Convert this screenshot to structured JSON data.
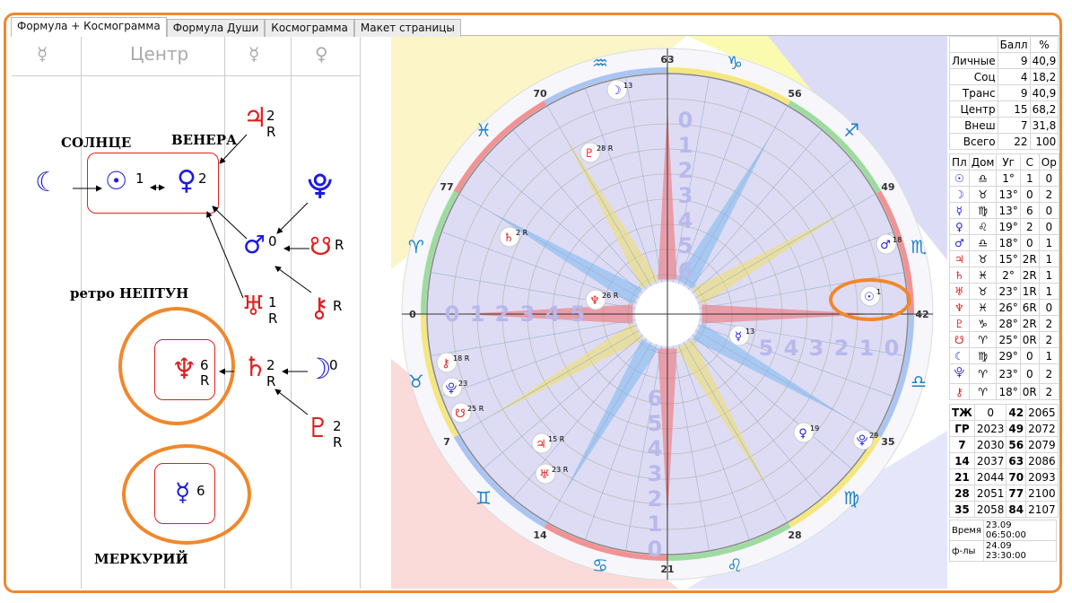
{
  "tabs": [
    "Формула + Космограмма",
    "Формула Души",
    "Космограмма",
    "Макет страницы"
  ],
  "active_tab": 0,
  "formula": {
    "headers": [
      "☿",
      "Центр",
      "☿",
      "♀"
    ],
    "labels": {
      "sun": "СОЛНЦЕ",
      "venus": "ВЕНЕРА",
      "neptune": "ретро НЕПТУН",
      "mercury": "МЕРКУРИЙ"
    },
    "glyphs": {
      "moon_left": "☾",
      "sun": "☉",
      "sun_num": "1",
      "venus": "♀",
      "venus_num": "2",
      "jupiter": "♃",
      "jupiter_num": "2",
      "jupiter_r": "R",
      "proserpina": "⯓",
      "mars": "♂",
      "mars_num": "0",
      "node": "☋",
      "node_r": "R",
      "uranus": "♅",
      "uranus_num": "1",
      "uranus_r": "R",
      "chiron": "⚷",
      "chiron_r": "R",
      "neptune": "♆",
      "neptune_num": "6",
      "neptune_r": "R",
      "saturn": "♄",
      "saturn_num": "2",
      "saturn_r": "R",
      "moon_right": "☽",
      "moon_num": "0",
      "pluto": "♇",
      "pluto_num": "2",
      "pluto_r": "R",
      "mercury": "☿",
      "mercury_num": "6"
    }
  },
  "chart": {
    "outer_numbers": [
      "63",
      "56",
      "49",
      "42",
      "35",
      "28",
      "21",
      "14",
      "7",
      "0",
      "77",
      "70"
    ],
    "inner_numbers_left": [
      "0",
      "1",
      "2",
      "3",
      "4",
      "5"
    ],
    "inner_numbers_right": [
      "5",
      "4",
      "3",
      "2",
      "1",
      "0"
    ],
    "inner_numbers_top": [
      "0",
      "1",
      "2",
      "3",
      "4",
      "5",
      "6"
    ],
    "inner_numbers_bottom": [
      "6",
      "5",
      "4",
      "3",
      "2",
      "1",
      "0"
    ],
    "signs": [
      "♑",
      "♐",
      "♏",
      "♎",
      "♍",
      "♌",
      "♋",
      "♊",
      "♉",
      "♈",
      "♓",
      "♒"
    ],
    "planets": [
      {
        "g": "☽",
        "n": "13"
      },
      {
        "g": "♇",
        "n": "28 R"
      },
      {
        "g": "♄",
        "n": "2 R"
      },
      {
        "g": "♆",
        "n": "26 R"
      },
      {
        "g": "⚷",
        "n": "18 R"
      },
      {
        "g": "⯓",
        "n": "23"
      },
      {
        "g": "☋",
        "n": "25 R"
      },
      {
        "g": "♃",
        "n": "15 R"
      },
      {
        "g": "♅",
        "n": "23 R"
      },
      {
        "g": "♂",
        "n": "18"
      },
      {
        "g": "☉",
        "n": "1"
      },
      {
        "g": "☿",
        "n": "13"
      },
      {
        "g": "♀",
        "n": "19"
      },
      {
        "g": "⯓",
        "n": "29"
      }
    ]
  },
  "stats": {
    "header": [
      "",
      "Балл",
      "%"
    ],
    "rows": [
      [
        "Личные",
        "9",
        "40,9"
      ],
      [
        "Соц",
        "4",
        "18,2"
      ],
      [
        "Транс",
        "9",
        "40,9"
      ],
      [
        "Центр",
        "15",
        "68,2"
      ],
      [
        "Внеш",
        "7",
        "31,8"
      ],
      [
        "Всего",
        "22",
        "100"
      ]
    ],
    "planet_header": [
      "Пл",
      "Дом",
      "Уг",
      "С",
      "Ор"
    ],
    "planet_rows": [
      [
        "☉",
        "♎",
        "1°",
        "1",
        "0"
      ],
      [
        "☽",
        "♉",
        "13°",
        "0",
        "2"
      ],
      [
        "☿",
        "♍",
        "13°",
        "6",
        "0"
      ],
      [
        "♀",
        "♌",
        "19°",
        "2",
        "0"
      ],
      [
        "♂",
        "♎",
        "18°",
        "0",
        "1"
      ],
      [
        "♃",
        "♉",
        "15°",
        "2R",
        "1"
      ],
      [
        "♄",
        "♓",
        "2°",
        "2R",
        "1"
      ],
      [
        "♅",
        "♉",
        "23°",
        "1R",
        "1"
      ],
      [
        "♆",
        "♓",
        "26°",
        "6R",
        "0"
      ],
      [
        "♇",
        "♑",
        "28°",
        "2R",
        "2"
      ],
      [
        "☋",
        "♈",
        "25°",
        "0R",
        "2"
      ],
      [
        "☾",
        "♍",
        "29°",
        "0",
        "1"
      ],
      [
        "⯓",
        "♈",
        "23°",
        "0",
        "2"
      ],
      [
        "⚷",
        "♈",
        "18°",
        "0R",
        "2"
      ]
    ],
    "cycles": [
      [
        "ТЖ",
        "0",
        "42",
        "2065"
      ],
      [
        "ГР",
        "2023",
        "49",
        "2072"
      ],
      [
        "7",
        "2030",
        "56",
        "2079"
      ],
      [
        "14",
        "2037",
        "63",
        "2086"
      ],
      [
        "21",
        "2044",
        "70",
        "2093"
      ],
      [
        "28",
        "2051",
        "77",
        "2100"
      ],
      [
        "35",
        "2058",
        "84",
        "2107"
      ]
    ],
    "time_label": "Время",
    "time_value": "23.09 06:50:00",
    "formula_label": "ф-лы",
    "formula_value": "24.09 23:30:00"
  },
  "colors": {
    "accent": "#f0882c",
    "red": "#e02020",
    "blue": "#1a1ae0"
  }
}
